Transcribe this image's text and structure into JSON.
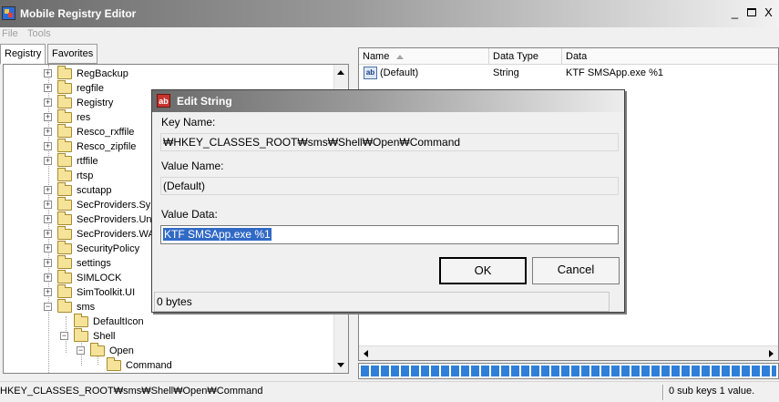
{
  "window": {
    "title": "Mobile Registry Editor",
    "controls": {
      "minimize": "_",
      "close": "X"
    }
  },
  "menu": {
    "file": "File",
    "tools": "Tools"
  },
  "tabs": [
    {
      "label": "Registry",
      "active": true
    },
    {
      "label": "Favorites",
      "active": false
    }
  ],
  "tree": {
    "items": [
      {
        "label": "RegBackup",
        "expandable": true,
        "expander": "+"
      },
      {
        "label": "regfile",
        "expandable": true,
        "expander": "+"
      },
      {
        "label": "Registry",
        "expandable": true,
        "expander": "+"
      },
      {
        "label": "res",
        "expandable": true,
        "expander": "+"
      },
      {
        "label": "Resco_rxffile",
        "expandable": true,
        "expander": "+"
      },
      {
        "label": "Resco_zipfile",
        "expandable": true,
        "expander": "+"
      },
      {
        "label": "rtffile",
        "expandable": true,
        "expander": "+"
      },
      {
        "label": "rtsp",
        "expandable": false,
        "expander": ""
      },
      {
        "label": "scutapp",
        "expandable": true,
        "expander": "+"
      },
      {
        "label": "SecProviders.Syr",
        "expandable": true,
        "expander": "+"
      },
      {
        "label": "SecProviders.Una",
        "expandable": true,
        "expander": "+"
      },
      {
        "label": "SecProviders.WA",
        "expandable": true,
        "expander": "+"
      },
      {
        "label": "SecurityPolicy",
        "expandable": true,
        "expander": "+"
      },
      {
        "label": "settings",
        "expandable": true,
        "expander": "+"
      },
      {
        "label": "SIMLOCK",
        "expandable": true,
        "expander": "+"
      },
      {
        "label": "SimToolkit.UI",
        "expandable": true,
        "expander": "+"
      },
      {
        "label": "sms",
        "expandable": true,
        "expander": "−"
      },
      {
        "label": "DefaultIcon",
        "expandable": false,
        "expander": ""
      },
      {
        "label": "Shell",
        "expandable": true,
        "expander": "−"
      },
      {
        "label": "Open",
        "expandable": true,
        "expander": "−"
      },
      {
        "label": "Command",
        "expandable": false,
        "expander": ""
      }
    ]
  },
  "list": {
    "columns": [
      {
        "label": "Name",
        "sorted": true
      },
      {
        "label": "Data Type",
        "sorted": false
      },
      {
        "label": "Data",
        "sorted": false
      }
    ],
    "rows": [
      {
        "icon": "ab",
        "name": "(Default)",
        "type": "String",
        "data": "KTF SMSApp.exe %1"
      }
    ]
  },
  "progress": {
    "fraction": 1.0,
    "accent": "#2f7fd8"
  },
  "status": {
    "path": "HKEY_CLASSES_ROOT₩sms₩Shell₩Open₩Command",
    "count": "0 sub keys 1 value."
  },
  "dialog": {
    "title": "Edit String",
    "icon": "ab",
    "key_name_label": "Key Name:",
    "key_name_value": "₩HKEY_CLASSES_ROOT₩sms₩Shell₩Open₩Command",
    "value_name_label": "Value Name:",
    "value_name_value": "(Default)",
    "value_data_label": "Value Data:",
    "value_data_value": "KTF SMSApp.exe %1",
    "ok_label": "OK",
    "cancel_label": "Cancel",
    "status_text": "0 bytes"
  },
  "colors": {
    "selection": "#316ac5",
    "folder": "#f6e39a",
    "titlebar_dark": "#6b6b6b"
  }
}
